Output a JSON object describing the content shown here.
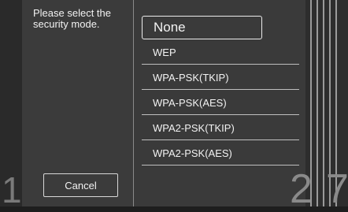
{
  "dialog": {
    "prompt": "Please select the security mode.",
    "cancel_label": "Cancel",
    "step_left": "1",
    "step_current": "2",
    "step_next": "7"
  },
  "options": [
    {
      "label": "None",
      "selected": true
    },
    {
      "label": "WEP",
      "selected": false
    },
    {
      "label": "WPA-PSK(TKIP)",
      "selected": false
    },
    {
      "label": "WPA-PSK(AES)",
      "selected": false
    },
    {
      "label": "WPA2-PSK(TKIP)",
      "selected": false
    },
    {
      "label": "WPA2-PSK(AES)",
      "selected": false
    }
  ],
  "colors": {
    "background": "#3a3a3a",
    "text": "#f2f2f2",
    "divider": "#bfbfbf"
  }
}
